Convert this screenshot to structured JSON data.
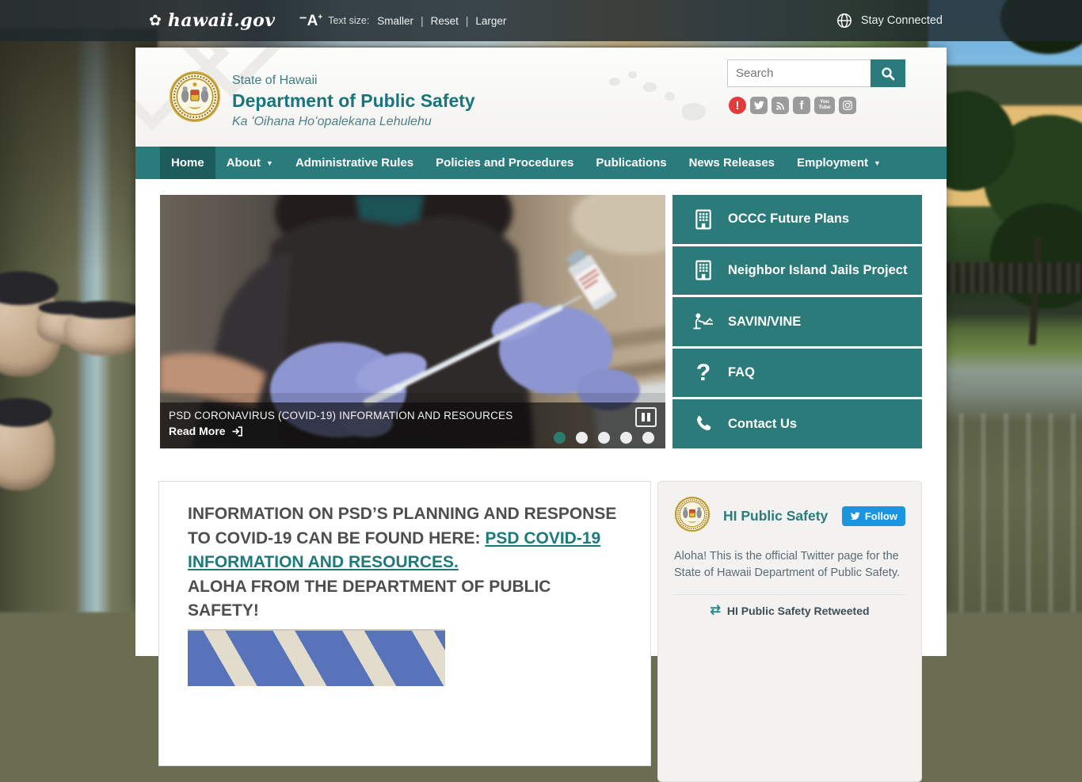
{
  "topbar": {
    "logo": "hawaii.gov",
    "text_size_label": "Text size:",
    "links": [
      "Smaller",
      "Reset",
      "Larger"
    ],
    "stay_connected": "Stay Connected"
  },
  "header": {
    "agency_super": "State of Hawaii",
    "agency_name": "Department of Public Safety",
    "agency_hawaiian": "Ka ʻOihana Hoʻopalekana Lehulehu",
    "search_placeholder": "Search",
    "social_icons": [
      "alert-icon",
      "twitter-icon",
      "rss-icon",
      "facebook-icon",
      "youtube-icon",
      "instagram-icon"
    ],
    "youtube_line1": "You",
    "youtube_line2": "Tube"
  },
  "nav": {
    "items": [
      {
        "label": "Home",
        "active": true,
        "dropdown": false
      },
      {
        "label": "About",
        "active": false,
        "dropdown": true
      },
      {
        "label": "Administrative Rules",
        "active": false,
        "dropdown": false
      },
      {
        "label": "Policies and Procedures",
        "active": false,
        "dropdown": false
      },
      {
        "label": "Publications",
        "active": false,
        "dropdown": false
      },
      {
        "label": "News Releases",
        "active": false,
        "dropdown": false
      },
      {
        "label": "Employment",
        "active": false,
        "dropdown": true
      }
    ]
  },
  "carousel": {
    "caption": "PSD CORONAVIRUS (COVID-19) INFORMATION AND RESOURCES",
    "read_more": "Read More",
    "dots_total": 5,
    "active_dot": 1,
    "image_description": "gloved hands drawing covid vaccine from vial with syringe"
  },
  "quick_links": [
    {
      "label": "OCCC Future Plans",
      "icon": "building-icon"
    },
    {
      "label": "Neighbor Island Jails Project",
      "icon": "building-icon"
    },
    {
      "label": "SAVIN/VINE",
      "icon": "person-computer-icon"
    },
    {
      "label": "FAQ",
      "icon": "question-icon"
    },
    {
      "label": "Contact Us",
      "icon": "phone-icon"
    }
  ],
  "main": {
    "intro_prefix": "INFORMATION ON PSD’S PLANNING AND RESPONSE TO COVID-19 CAN BE FOUND HERE: ",
    "intro_link": "PSD COVID-19 INFORMATION AND RESOURCES.",
    "aloha_line": "ALOHA FROM THE DEPARTMENT OF PUBLIC SAFETY!"
  },
  "twitter": {
    "name": "HI Public Safety",
    "follow_label": "Follow",
    "bio": "Aloha! This is the official Twitter page for the State of Hawaii Department of Public Safety.",
    "retweeted_label": "HI Public Safety Retweeted"
  },
  "colors": {
    "teal_nav": "#2a7c7c",
    "teal_nav_active": "#1d5c5c",
    "teal_title": "#19747c",
    "teal_link": "#1e7a7a",
    "dot_active": "#2a7d6e",
    "follow_blue": "#1b95e0",
    "alert_red": "#e23b3b",
    "topbar_overlay": "rgba(30,40,44,0.82)"
  }
}
